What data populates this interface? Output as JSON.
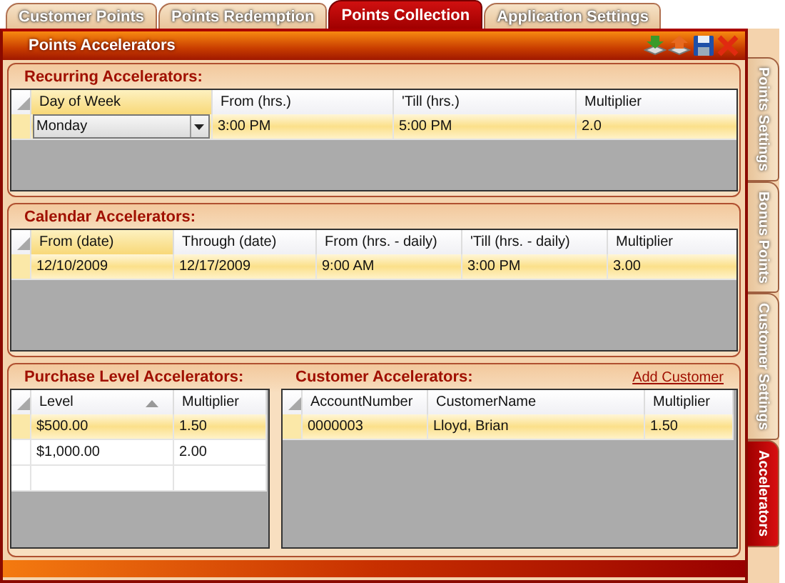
{
  "tabs": [
    {
      "label": "Customer Points",
      "selected": false
    },
    {
      "label": "Points Redemption",
      "selected": false
    },
    {
      "label": "Points Collection",
      "selected": true
    },
    {
      "label": "Application Settings",
      "selected": false
    }
  ],
  "panel": {
    "title": "Points Accelerators"
  },
  "side_tabs": [
    {
      "label": "Points Settings",
      "selected": false
    },
    {
      "label": "Bonus Points",
      "selected": false
    },
    {
      "label": "Customer Settings",
      "selected": false
    },
    {
      "label": "Accelerators",
      "selected": true
    }
  ],
  "recurring": {
    "title": "Recurring Accelerators:",
    "columns": [
      {
        "label": "Day of Week",
        "selected": true
      },
      {
        "label": "From (hrs.)",
        "selected": false
      },
      {
        "label": "'Till (hrs.)",
        "selected": false
      },
      {
        "label": "Multiplier",
        "selected": false
      }
    ],
    "rows": [
      {
        "selected": true,
        "cells": [
          {
            "kind": "dropdown",
            "text": "Monday"
          },
          {
            "kind": "text",
            "text": "3:00 PM"
          },
          {
            "kind": "text",
            "text": "5:00 PM"
          },
          {
            "kind": "text",
            "text": "2.0"
          }
        ]
      }
    ]
  },
  "calendar": {
    "title": "Calendar Accelerators:",
    "columns": [
      {
        "label": "From (date)",
        "selected": true
      },
      {
        "label": "Through (date)",
        "selected": false
      },
      {
        "label": "From (hrs. - daily)",
        "selected": false
      },
      {
        "label": "'Till (hrs. - daily)",
        "selected": false
      },
      {
        "label": "Multiplier",
        "selected": false
      }
    ],
    "rows": [
      {
        "selected": true,
        "cells": [
          {
            "kind": "text",
            "text": "12/10/2009"
          },
          {
            "kind": "text",
            "text": "12/17/2009"
          },
          {
            "kind": "text",
            "text": "9:00 AM"
          },
          {
            "kind": "text",
            "text": "3:00 PM"
          },
          {
            "kind": "text",
            "text": "3.00"
          }
        ]
      }
    ]
  },
  "purchase": {
    "title": "Purchase Level Accelerators:",
    "new_row": true,
    "columns": [
      {
        "label": "Level",
        "selected": false,
        "sorted": true
      },
      {
        "label": "Multiplier",
        "selected": false,
        "sorted": false
      }
    ],
    "rows": [
      {
        "selected": true,
        "cells": [
          {
            "kind": "text",
            "text": "$500.00"
          },
          {
            "kind": "text",
            "text": "1.50"
          }
        ]
      },
      {
        "selected": false,
        "cells": [
          {
            "kind": "text",
            "text": "$1,000.00"
          },
          {
            "kind": "text",
            "text": "2.00"
          }
        ]
      }
    ]
  },
  "customer": {
    "title": "Customer Accelerators:",
    "link": "Add Customer",
    "new_row": false,
    "columns": [
      {
        "label": "AccountNumber",
        "selected": false
      },
      {
        "label": "CustomerName",
        "selected": false
      },
      {
        "label": "Multiplier",
        "selected": false
      }
    ],
    "rows": [
      {
        "selected": true,
        "cells": [
          {
            "kind": "text",
            "text": "0000003"
          },
          {
            "kind": "text",
            "text": "Lloyd, Brian"
          },
          {
            "kind": "text",
            "text": "1.50"
          }
        ]
      }
    ]
  }
}
